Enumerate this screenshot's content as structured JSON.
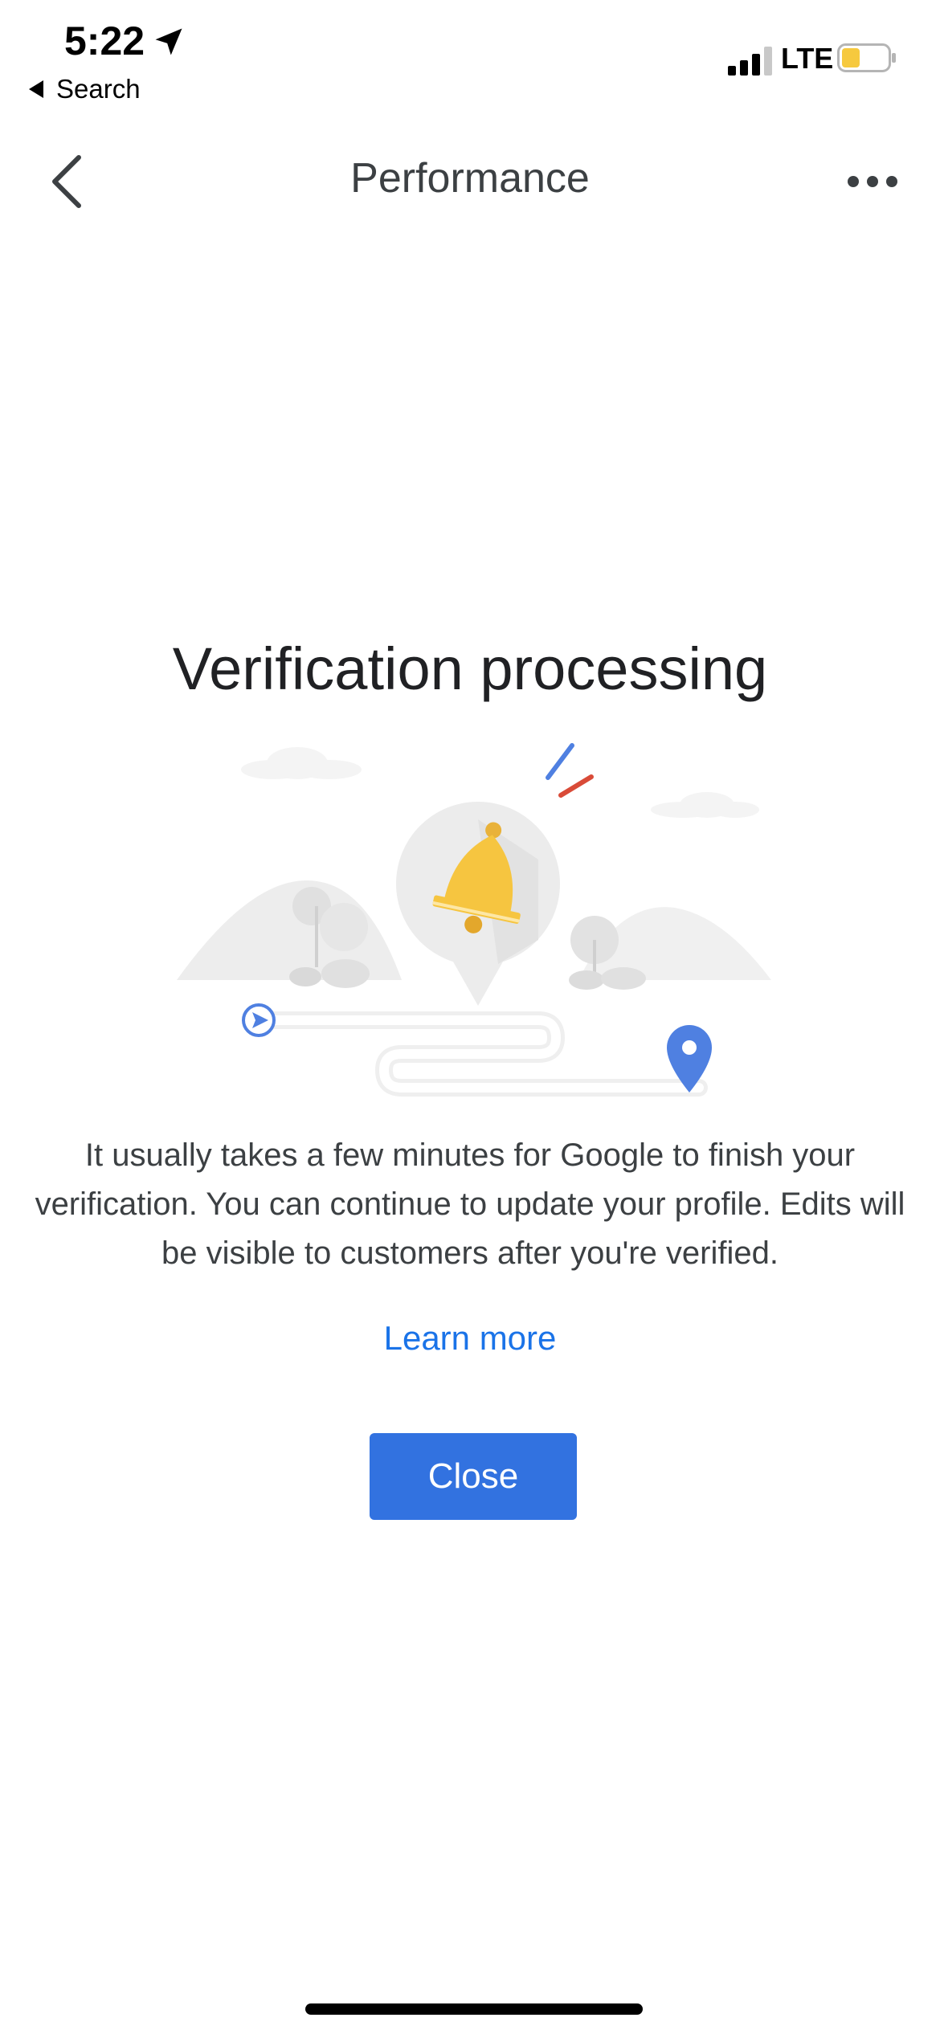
{
  "status_bar": {
    "time": "5:22",
    "back_app_label": "Search",
    "network": "LTE",
    "battery_color": "#f6c93e"
  },
  "app_bar": {
    "title": "Performance",
    "back_icon": "chevron-left-icon",
    "more_icon": "more-horiz-icon"
  },
  "content": {
    "headline": "Verification processing",
    "body": "It usually takes a few minutes for Google to finish your verification. You can continue to update your profile. Edits will be visible to customers after you're verified.",
    "learn_more": "Learn more",
    "close_label": "Close"
  },
  "colors": {
    "accent_blue": "#3272e0",
    "link_blue": "#1a73e8",
    "bell_yellow": "#f6c540",
    "spark_red": "#d94b38",
    "spark_blue": "#4f80e1"
  }
}
